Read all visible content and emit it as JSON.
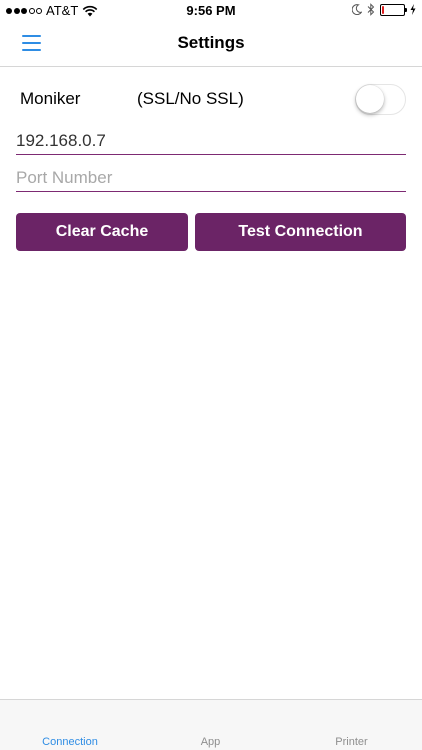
{
  "status_bar": {
    "carrier": "AT&T",
    "time": "9:56 PM",
    "signal_bars_filled": 3,
    "signal_bars_total": 5,
    "battery_level": 0.1,
    "battery_color": "#e02020",
    "icons": [
      "wifi-icon",
      "moon-icon",
      "bluetooth-icon",
      "charging-icon"
    ]
  },
  "nav": {
    "title": "Settings",
    "menu_icon": "hamburger-menu-icon",
    "accent_color": "#2f8de4"
  },
  "form": {
    "moniker_label": "Moniker",
    "ssl_label": "(SSL/No SSL)",
    "ssl_enabled": false,
    "ip_value": "192.168.0.7",
    "port_value": "",
    "port_placeholder": "Port Number",
    "clear_cache_label": "Clear Cache",
    "test_connection_label": "Test Connection",
    "button_color": "#6b2466",
    "underline_color": "#7d2a73"
  },
  "tabs": [
    {
      "label": "Connection",
      "active": true
    },
    {
      "label": "App",
      "active": false
    },
    {
      "label": "Printer",
      "active": false
    }
  ]
}
